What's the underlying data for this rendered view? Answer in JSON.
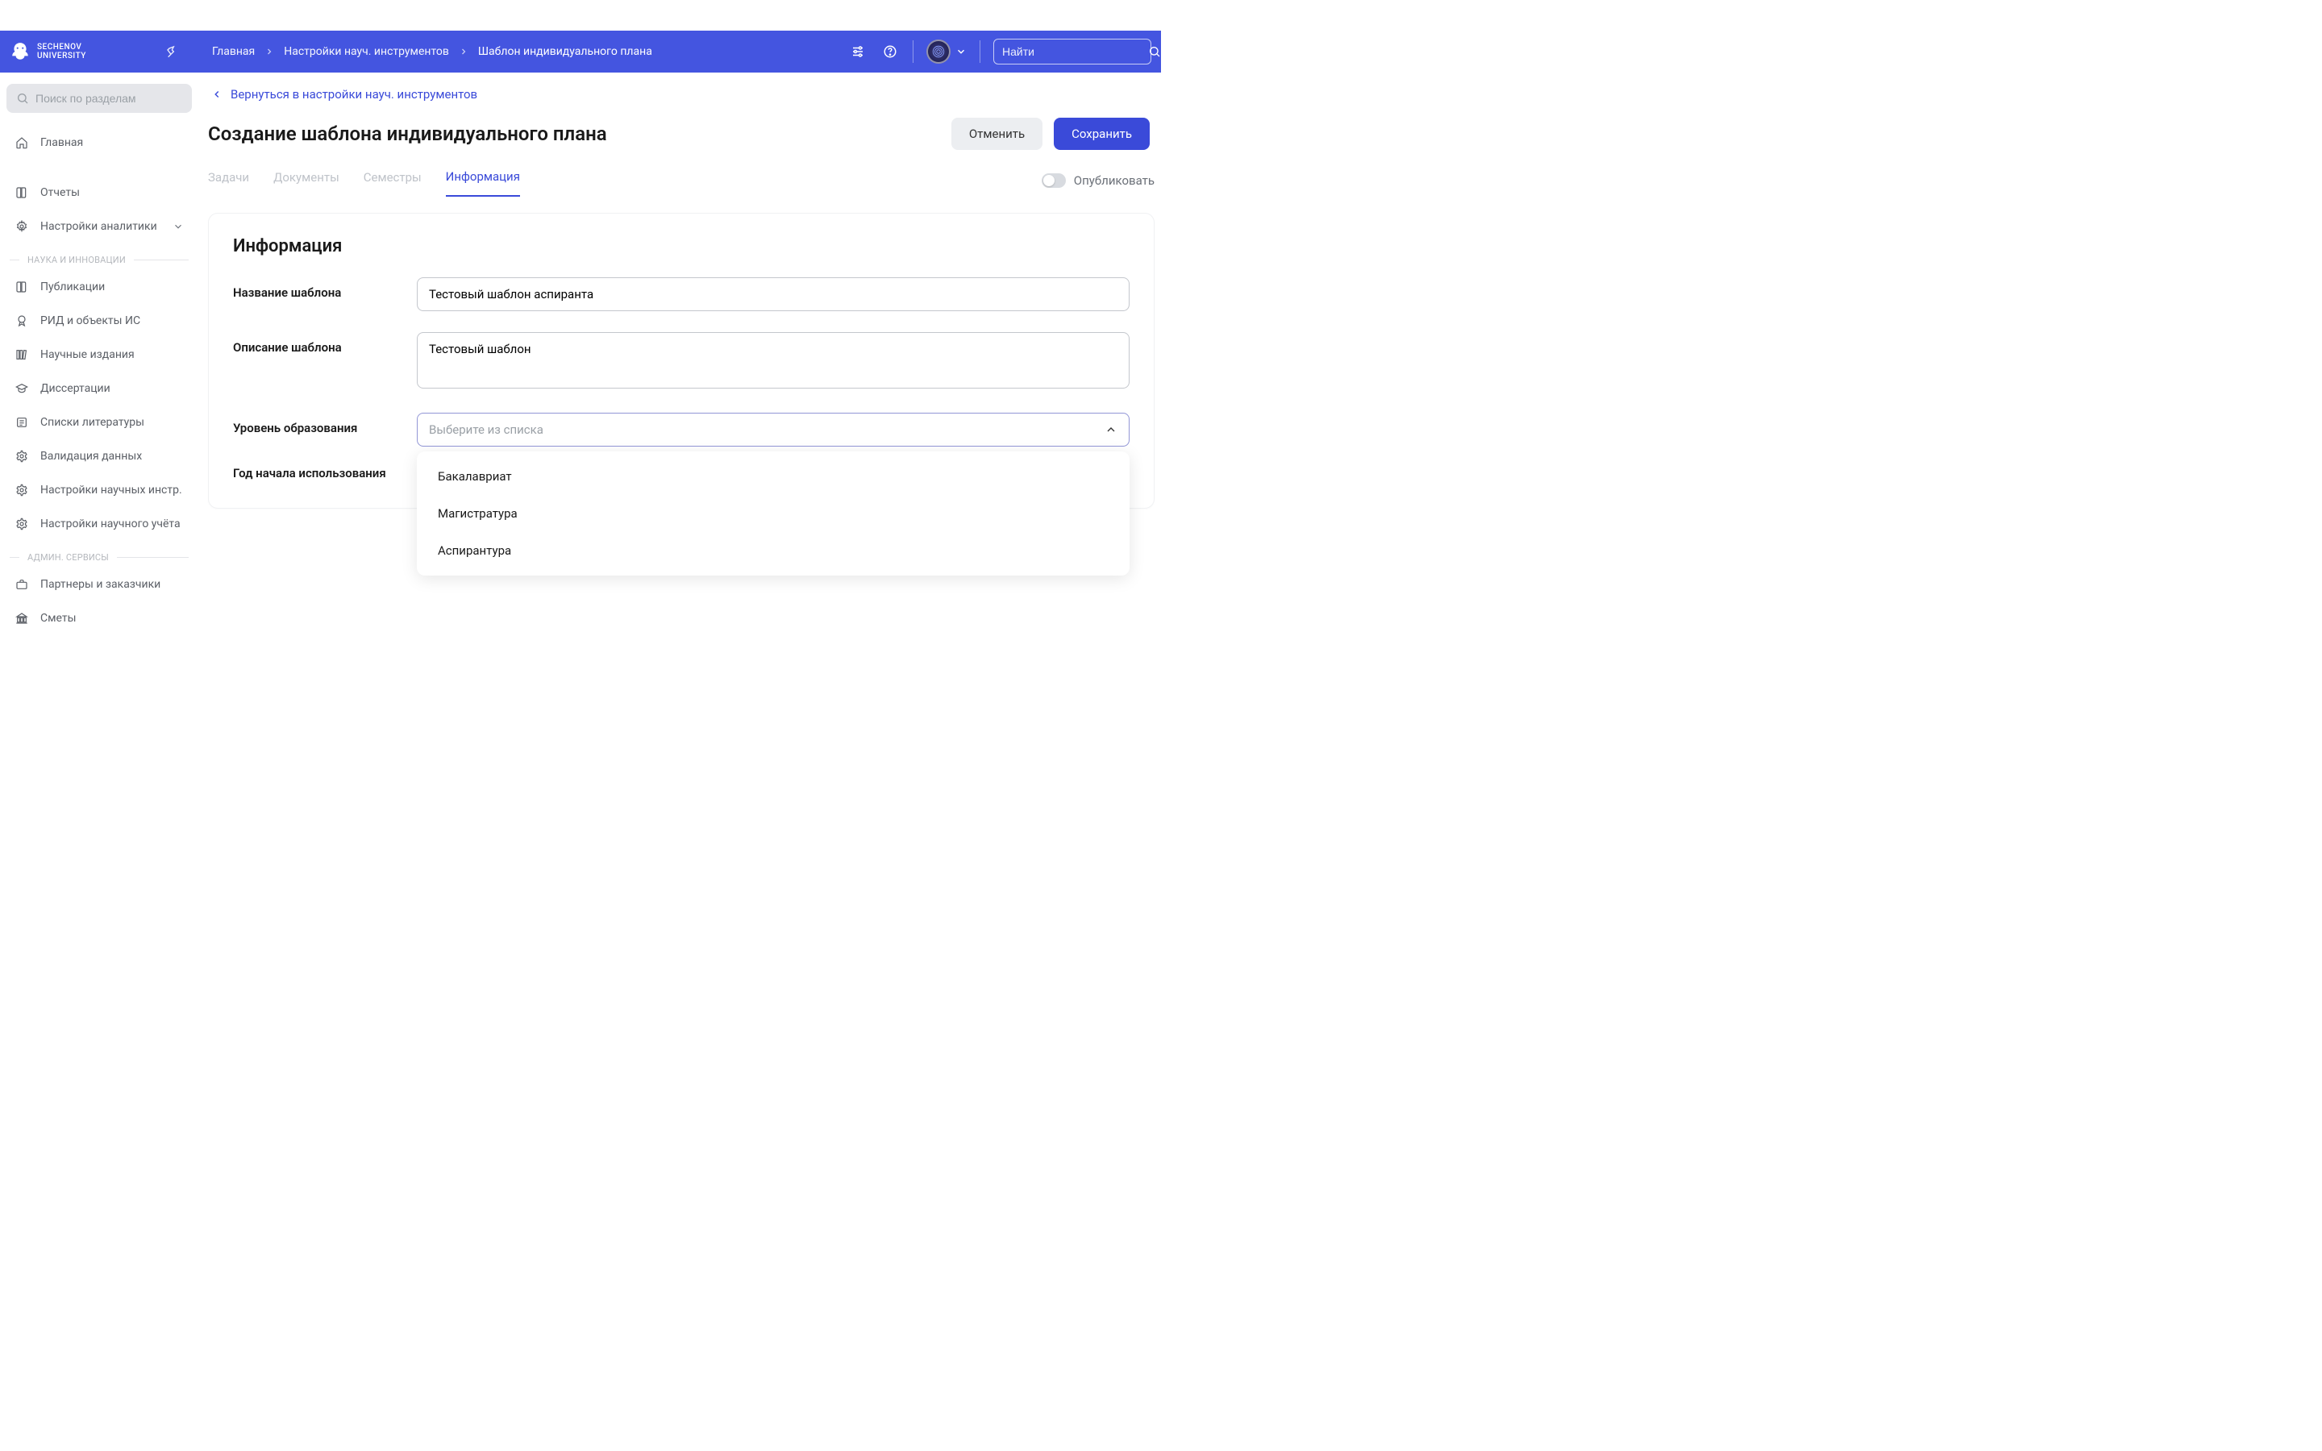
{
  "brand": {
    "line1": "SECHENOV",
    "line2": "UNIVERSITY"
  },
  "breadcrumb": {
    "items": [
      {
        "label": "Главная"
      },
      {
        "label": "Настройки науч. инструментов"
      },
      {
        "label": "Шаблон индивидуального плана"
      }
    ]
  },
  "top_search": {
    "placeholder": "Найти"
  },
  "sidebar": {
    "search_placeholder": "Поиск по разделам",
    "items_top": [
      {
        "label": "Главная",
        "icon": "home"
      },
      {
        "label": "Отчеты",
        "icon": "book"
      },
      {
        "label": "Настройки аналитики",
        "icon": "gear",
        "chevron": true
      }
    ],
    "group1": "НАУКА И ИННОВАЦИИ",
    "items_science": [
      {
        "label": "Публикации",
        "icon": "book"
      },
      {
        "label": "РИД и объекты ИС",
        "icon": "award"
      },
      {
        "label": "Научные издания",
        "icon": "library"
      },
      {
        "label": "Диссертации",
        "icon": "grad"
      },
      {
        "label": "Списки литературы",
        "icon": "list"
      },
      {
        "label": "Валидация данных",
        "icon": "gear"
      },
      {
        "label": "Настройки научных инстр.",
        "icon": "gear"
      },
      {
        "label": "Настройки научного учёта",
        "icon": "gear"
      }
    ],
    "group2": "АДМИН. СЕРВИСЫ",
    "items_admin": [
      {
        "label": "Партнеры и заказчики",
        "icon": "briefcase"
      },
      {
        "label": "Сметы",
        "icon": "bank"
      }
    ]
  },
  "back_link": "Вернуться в настройки науч. инструментов",
  "page_title": "Создание шаблона индивидуального плана",
  "buttons": {
    "cancel": "Отменить",
    "save": "Сохранить"
  },
  "tabs": [
    {
      "label": "Задачи"
    },
    {
      "label": "Документы"
    },
    {
      "label": "Семестры"
    },
    {
      "label": "Информация",
      "active": true
    }
  ],
  "publish_label": "Опубликовать",
  "form": {
    "heading": "Информация",
    "labels": {
      "name": "Название шаблона",
      "desc": "Описание шаблона",
      "level": "Уровень образования",
      "year": "Год начала использования"
    },
    "values": {
      "name": "Тестовый шаблон аспиранта",
      "desc": "Тестовый шаблон"
    },
    "level_placeholder": "Выберите из списка",
    "level_options": [
      "Бакалавриат",
      "Магистратура",
      "Аспирантура"
    ]
  }
}
